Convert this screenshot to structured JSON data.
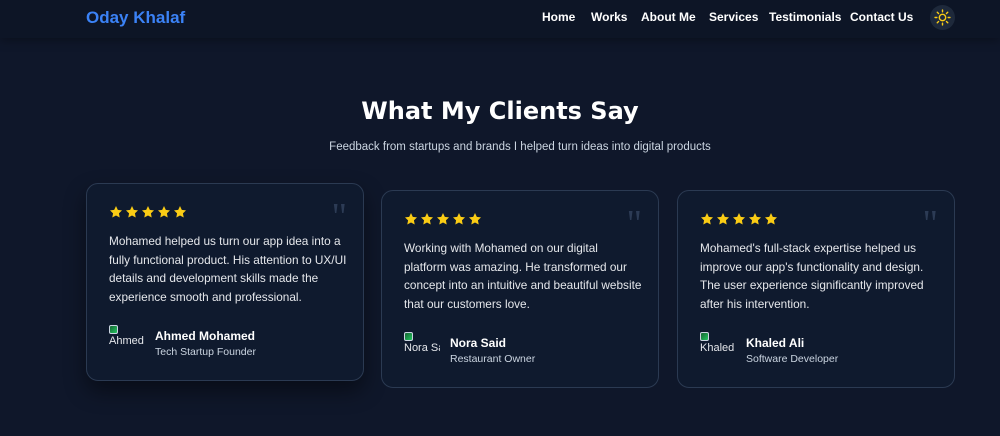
{
  "nav": {
    "brand": "Oday Khalaf",
    "items": [
      "Home",
      "Works",
      "About Me",
      "Services",
      "Testimonials",
      "Contact Us"
    ],
    "theme_icon": "sun-icon"
  },
  "section": {
    "title": "What My Clients Say",
    "subtitle": "Feedback from startups and brands I helped turn ideas into digital products"
  },
  "testimonials": [
    {
      "rating": 5,
      "text": "Mohamed helped us turn our app idea into a fully functional product. His attention to UX/UI details and development skills made the experience smooth and professional.",
      "name": "Ahmed Mohamed",
      "role": "Tech Startup Founder",
      "avatar_alt": "Ahmed Mohamed"
    },
    {
      "rating": 5,
      "text": "Working with Mohamed on our digital platform was amazing. He transformed our concept into an intuitive and beautiful website that our customers love.",
      "name": "Nora Said",
      "role": "Restaurant Owner",
      "avatar_alt": "Nora Said"
    },
    {
      "rating": 5,
      "text": "Mohamed's full-stack expertise helped us improve our app's functionality and design. The user experience significantly improved after his intervention.",
      "name": "Khaled Ali",
      "role": "Software Developer",
      "avatar_alt": "Khaled Ali"
    }
  ],
  "colors": {
    "background": "#0f172a",
    "brand": "#3b82f6",
    "star": "#facc15",
    "card_border": "#2b3a52"
  }
}
